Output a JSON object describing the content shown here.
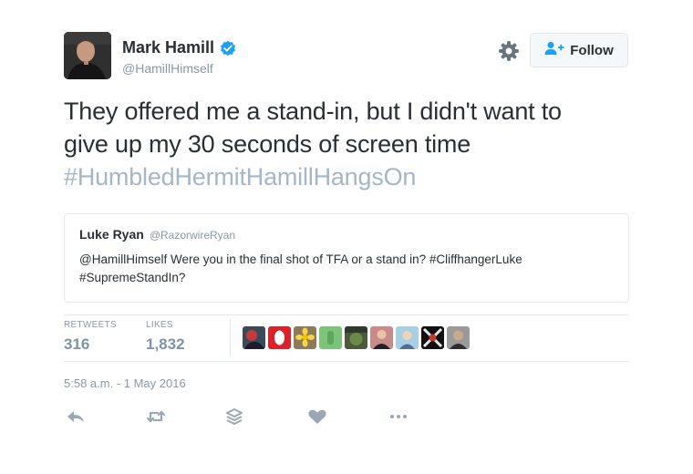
{
  "author": {
    "display_name": "Mark Hamill",
    "screen_name": "@HamillHimself",
    "verified": true
  },
  "follow_button": {
    "label": "Follow"
  },
  "tweet": {
    "lines": [
      "They offered me a stand-in, but I didn't want to",
      "give up my 30 seconds of screen time"
    ],
    "hashtag": "#HumbledHermitHamillHangsOn"
  },
  "quoted_tweet": {
    "name": "Luke Ryan",
    "handle": "@RazorwireRyan",
    "text": "@HamillHimself Were you in the final shot of TFA or a stand in? #CliffhangerLuke #SupremeStandIn?"
  },
  "stats": {
    "retweets_label": "RETWEETS",
    "retweets": "316",
    "likes_label": "LIKES",
    "likes": "1,832"
  },
  "timestamp": "5:58 a.m. - 1 May 2016",
  "icons": {
    "verified": "verified-badge-icon",
    "settings": "gear-icon",
    "follow": "add-user-icon",
    "reply": "reply-icon",
    "retweet": "retweet-icon",
    "stack": "stack-icon",
    "like": "heart-icon",
    "more": "more-icon"
  },
  "colors": {
    "hashtag": "#a4b7c8",
    "verified": "#1da1f2",
    "muted": "#8899a6",
    "border": "#e1e8ed"
  }
}
